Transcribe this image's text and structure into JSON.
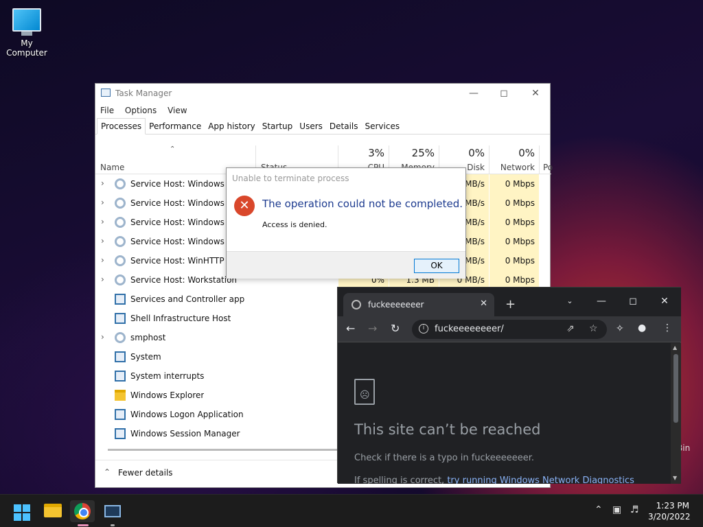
{
  "desktop": {
    "icon_label": "My Computer",
    "recycle_label": "Bin"
  },
  "taskmanager": {
    "title": "Task Manager",
    "menu": [
      "File",
      "Options",
      "View"
    ],
    "tabs": [
      "Processes",
      "Performance",
      "App history",
      "Startup",
      "Users",
      "Details",
      "Services"
    ],
    "columns": {
      "name": "Name",
      "status": "Status",
      "cpu_pct": "3%",
      "cpu": "CPU",
      "mem_pct": "25%",
      "mem": "Memory",
      "disk_pct": "0%",
      "disk": "Disk",
      "net_pct": "0%",
      "net": "Network",
      "power": "Po"
    },
    "rows": [
      {
        "name": "Service Host: Windows Pus",
        "cpu": "",
        "mem": "",
        "disk": "MB/s",
        "net": "0 Mbps"
      },
      {
        "name": "Service Host: Windows Pus",
        "cpu": "",
        "mem": "",
        "disk": "MB/s",
        "net": "0 Mbps"
      },
      {
        "name": "Service Host: Windows Tim",
        "cpu": "",
        "mem": "",
        "disk": "MB/s",
        "net": "0 Mbps"
      },
      {
        "name": "Service Host: Windows Up",
        "cpu": "",
        "mem": "",
        "disk": "MB/s",
        "net": "0 Mbps"
      },
      {
        "name": "Service Host: WinHTTP We",
        "cpu": "",
        "mem": "",
        "disk": "MB/s",
        "net": "0 Mbps"
      },
      {
        "name": "Service Host: Workstation",
        "cpu": "0%",
        "mem": "1.3 MB",
        "disk": "0 MB/s",
        "net": "0 Mbps"
      },
      {
        "name": "Services and Controller app"
      },
      {
        "name": "Shell Infrastructure Host"
      },
      {
        "name": "smphost"
      },
      {
        "name": "System"
      },
      {
        "name": "System interrupts"
      },
      {
        "name": "Windows Explorer"
      },
      {
        "name": "Windows Logon Application"
      },
      {
        "name": "Windows Session Manager"
      }
    ],
    "footer": "Fewer details"
  },
  "dialog": {
    "title": "Unable to terminate process",
    "message": "The operation could not be completed.",
    "detail": "Access is denied.",
    "ok": "OK"
  },
  "chrome": {
    "tab_title": "fuckeeeeeeer",
    "url": "fuckeeeeeeeer/",
    "error_title": "This site can’t be reached",
    "hint": "Check if there is a typo in fuckeeeeeeer.",
    "more_prefix": "If spelling is correct, ",
    "more_link": "try running Windows Network Diagnostics"
  },
  "taskbar": {
    "time": "1:23 PM",
    "date": "3/20/2022"
  }
}
